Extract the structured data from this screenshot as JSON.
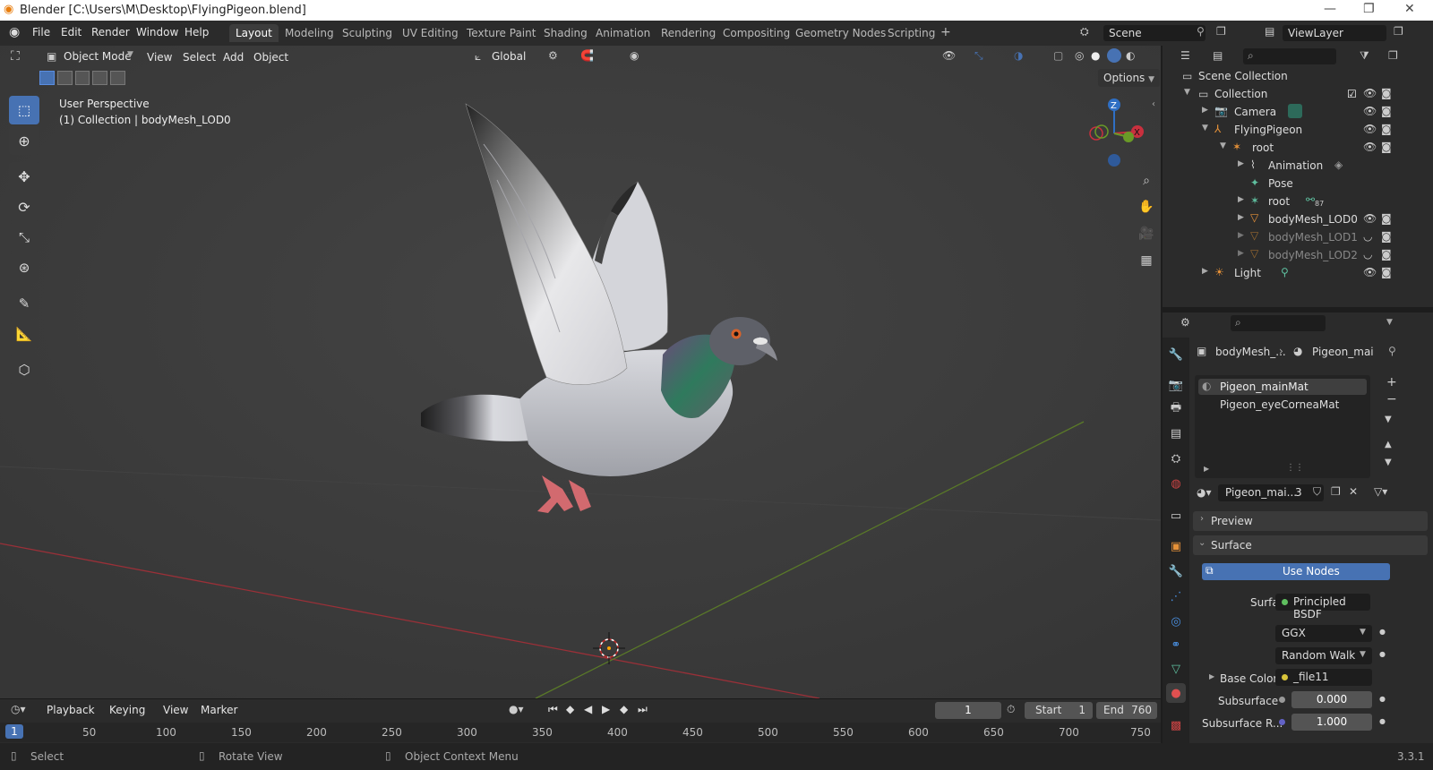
{
  "window": {
    "title": "Blender [C:\\Users\\M\\Desktop\\FlyingPigeon.blend]",
    "controls": [
      "—",
      "❐",
      "✕"
    ]
  },
  "menu": [
    "File",
    "Edit",
    "Render",
    "Window",
    "Help"
  ],
  "workspaces": [
    "Layout",
    "Modeling",
    "Sculpting",
    "UV Editing",
    "Texture Paint",
    "Shading",
    "Animation",
    "Rendering",
    "Compositing",
    "Geometry Nodes",
    "Scripting"
  ],
  "active_workspace": "Layout",
  "scene_name": "Scene",
  "view_layer": "ViewLayer",
  "viewport": {
    "mode": "Object Mode",
    "menus": [
      "View",
      "Select",
      "Add",
      "Object"
    ],
    "orientation": "Global",
    "options": "Options",
    "info_line1": "User Perspective",
    "info_line2": "(1) Collection | bodyMesh_LOD0",
    "gizmo": {
      "z": "Z",
      "x": "X"
    }
  },
  "outliner": {
    "rows": [
      {
        "label": "Scene Collection",
        "depth": 0
      },
      {
        "label": "Collection",
        "depth": 1
      },
      {
        "label": "Camera",
        "depth": 2
      },
      {
        "label": "FlyingPigeon",
        "depth": 2
      },
      {
        "label": "root",
        "depth": 3
      },
      {
        "label": "Animation",
        "depth": 4
      },
      {
        "label": "Pose",
        "depth": 4
      },
      {
        "label": "root",
        "depth": 4,
        "badge": "87"
      },
      {
        "label": "bodyMesh_LOD0",
        "depth": 4
      },
      {
        "label": "bodyMesh_LOD1",
        "depth": 4
      },
      {
        "label": "bodyMesh_LOD2",
        "depth": 4
      },
      {
        "label": "Light",
        "depth": 2
      }
    ]
  },
  "properties": {
    "breadcrumb_object": "bodyMesh_...",
    "breadcrumb_material": "Pigeon_mai",
    "material_slots": [
      "Pigeon_mainMat",
      "Pigeon_eyeCorneaMat"
    ],
    "material_name": "Pigeon_mai...",
    "material_users": "3",
    "preview_label": "Preview",
    "surface_label": "Surface",
    "use_nodes": "Use Nodes",
    "surface_field_label": "Surface",
    "surface_shader": "Principled BSDF",
    "distribution": "GGX",
    "subsurface_method": "Random Walk",
    "base_color_label": "Base Color",
    "base_color_value": "_file11",
    "subsurface_label": "Subsurface",
    "subsurface_value": "0.000",
    "subsurface_r_label": "Subsurface R...",
    "subsurface_r_value": "1.000"
  },
  "timeline": {
    "menus": [
      "Playback",
      "Keying",
      "View",
      "Marker"
    ],
    "current_frame": "1",
    "start_label": "Start",
    "start": "1",
    "end_label": "End",
    "end": "760",
    "ruler": [
      "1",
      "50",
      "100",
      "150",
      "200",
      "250",
      "300",
      "350",
      "400",
      "450",
      "500",
      "550",
      "600",
      "650",
      "700",
      "750"
    ]
  },
  "status": {
    "select": "Select",
    "rotate": "Rotate View",
    "context": "Object Context Menu",
    "version": "3.3.1"
  },
  "colors": {
    "accent": "#4772b3",
    "x_axis": "#c9303e",
    "y_axis": "#6a9a27",
    "z_axis": "#2f6fc4"
  }
}
